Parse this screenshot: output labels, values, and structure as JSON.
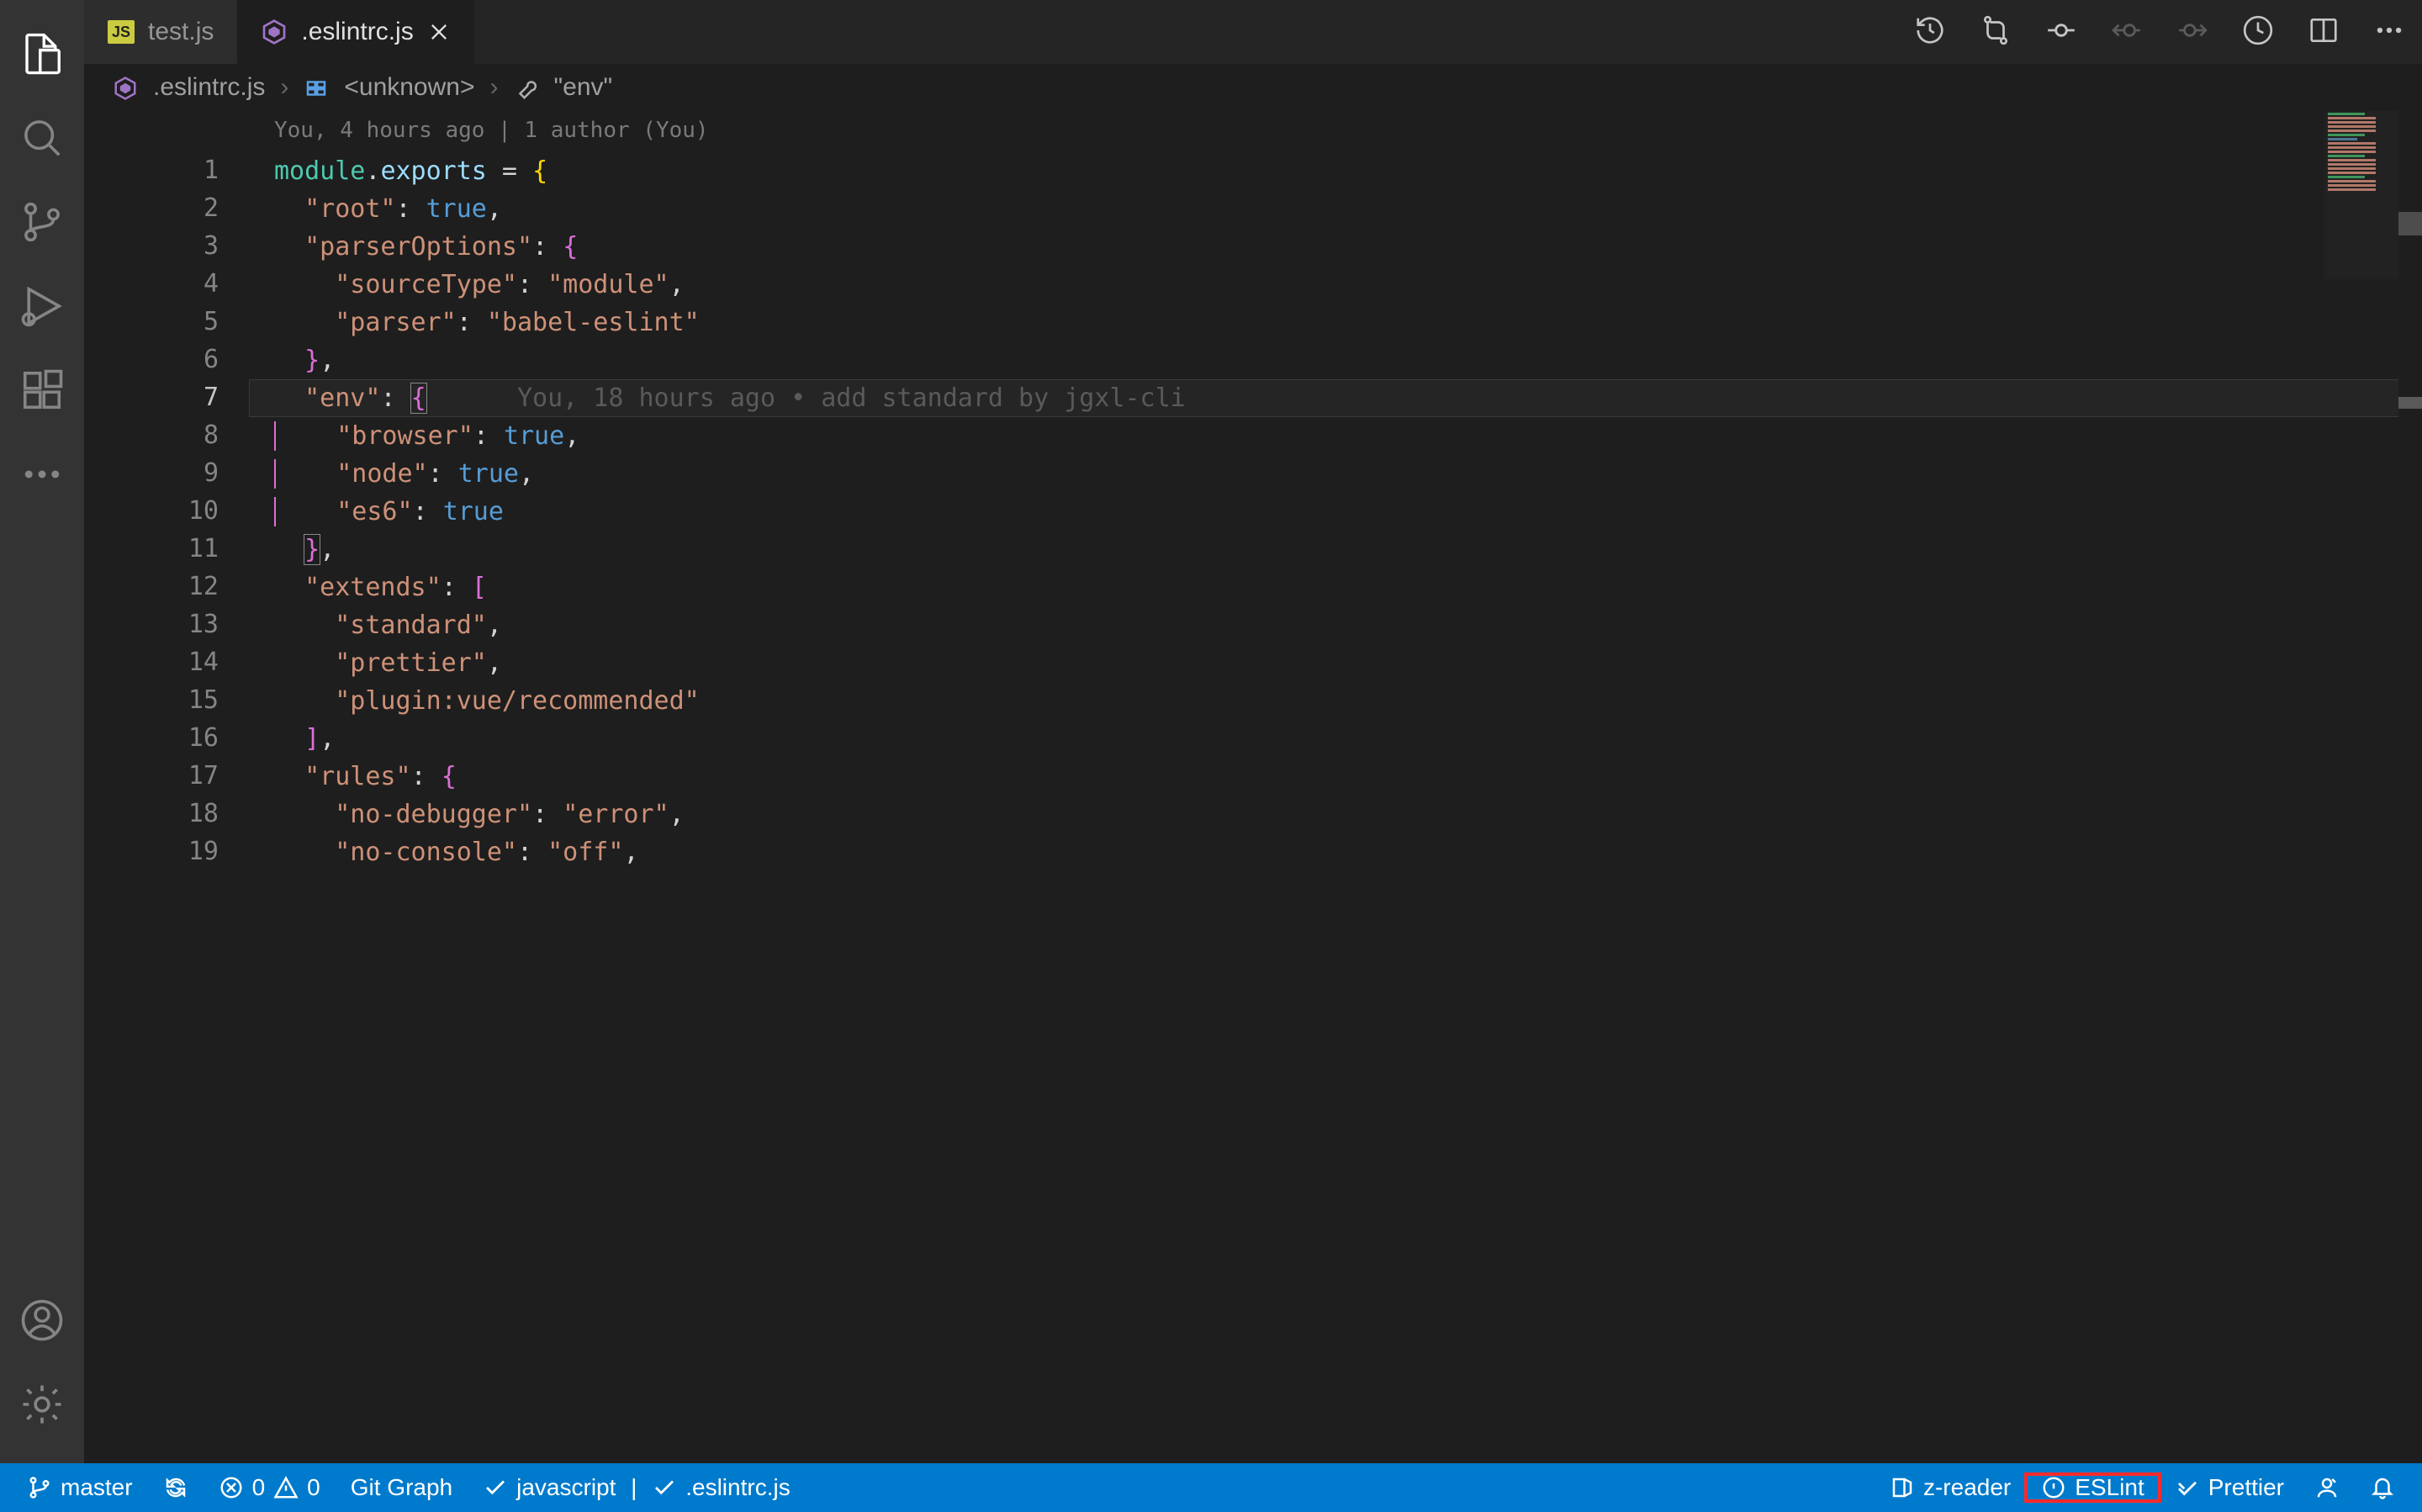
{
  "tabs": [
    {
      "label": "test.js",
      "icon": "js",
      "active": false
    },
    {
      "label": ".eslintrc.js",
      "icon": "eslint",
      "active": true
    }
  ],
  "breadcrumb": {
    "file": ".eslintrc.js",
    "symbol1": "<unknown>",
    "symbol2": "\"env\""
  },
  "codelens": "You, 4 hours ago | 1 author (You)",
  "blame_current_line": "You, 18 hours ago • add standard by jgxl-cli",
  "lines": [
    {
      "n": 1,
      "seg": [
        [
          "module",
          "var"
        ],
        [
          ".",
          "punc"
        ],
        [
          "exports",
          "prop"
        ],
        [
          " = ",
          "punc"
        ],
        [
          "{",
          "brace"
        ]
      ]
    },
    {
      "n": 2,
      "seg": [
        [
          "  ",
          ""
        ],
        [
          "\"root\"",
          "str"
        ],
        [
          ": ",
          "punc"
        ],
        [
          "true",
          "bool"
        ],
        [
          ",",
          "punc"
        ]
      ]
    },
    {
      "n": 3,
      "seg": [
        [
          "  ",
          ""
        ],
        [
          "\"parserOptions\"",
          "str"
        ],
        [
          ": ",
          "punc"
        ],
        [
          "{",
          "brace2"
        ]
      ]
    },
    {
      "n": 4,
      "seg": [
        [
          "    ",
          ""
        ],
        [
          "\"sourceType\"",
          "str"
        ],
        [
          ": ",
          "punc"
        ],
        [
          "\"module\"",
          "str"
        ],
        [
          ",",
          "punc"
        ]
      ]
    },
    {
      "n": 5,
      "seg": [
        [
          "    ",
          ""
        ],
        [
          "\"parser\"",
          "str"
        ],
        [
          ": ",
          "punc"
        ],
        [
          "\"babel-eslint\"",
          "str"
        ]
      ]
    },
    {
      "n": 6,
      "seg": [
        [
          "  ",
          ""
        ],
        [
          "}",
          "brace2"
        ],
        [
          ",",
          "punc"
        ]
      ]
    },
    {
      "n": 7,
      "seg": [
        [
          "  ",
          ""
        ],
        [
          "\"env\"",
          "str"
        ],
        [
          ": ",
          "punc"
        ],
        [
          "{",
          "brace2-hl"
        ]
      ],
      "current": true,
      "blame": true
    },
    {
      "n": 8,
      "seg": [
        [
          "    ",
          ""
        ],
        [
          "\"browser\"",
          "str"
        ],
        [
          ": ",
          "punc"
        ],
        [
          "true",
          "bool"
        ],
        [
          ",",
          "punc"
        ]
      ],
      "guide": true
    },
    {
      "n": 9,
      "seg": [
        [
          "    ",
          ""
        ],
        [
          "\"node\"",
          "str"
        ],
        [
          ": ",
          "punc"
        ],
        [
          "true",
          "bool"
        ],
        [
          ",",
          "punc"
        ]
      ],
      "guide": true
    },
    {
      "n": 10,
      "seg": [
        [
          "    ",
          ""
        ],
        [
          "\"es6\"",
          "str"
        ],
        [
          ": ",
          "punc"
        ],
        [
          "true",
          "bool"
        ]
      ],
      "guide": true
    },
    {
      "n": 11,
      "seg": [
        [
          "  ",
          ""
        ],
        [
          "}",
          "brace2-hl"
        ],
        [
          ",",
          "punc"
        ]
      ]
    },
    {
      "n": 12,
      "seg": [
        [
          "  ",
          ""
        ],
        [
          "\"extends\"",
          "str"
        ],
        [
          ": ",
          "punc"
        ],
        [
          "[",
          "brace2"
        ]
      ]
    },
    {
      "n": 13,
      "seg": [
        [
          "    ",
          ""
        ],
        [
          "\"standard\"",
          "str"
        ],
        [
          ",",
          "punc"
        ]
      ]
    },
    {
      "n": 14,
      "seg": [
        [
          "    ",
          ""
        ],
        [
          "\"prettier\"",
          "str"
        ],
        [
          ",",
          "punc"
        ]
      ]
    },
    {
      "n": 15,
      "seg": [
        [
          "    ",
          ""
        ],
        [
          "\"plugin:vue/recommended\"",
          "str"
        ]
      ]
    },
    {
      "n": 16,
      "seg": [
        [
          "  ",
          ""
        ],
        [
          "]",
          "brace2"
        ],
        [
          ",",
          "punc"
        ]
      ]
    },
    {
      "n": 17,
      "seg": [
        [
          "  ",
          ""
        ],
        [
          "\"rules\"",
          "str"
        ],
        [
          ": ",
          "punc"
        ],
        [
          "{",
          "brace2"
        ]
      ]
    },
    {
      "n": 18,
      "seg": [
        [
          "    ",
          ""
        ],
        [
          "\"no-debugger\"",
          "str"
        ],
        [
          ": ",
          "punc"
        ],
        [
          "\"error\"",
          "str"
        ],
        [
          ",",
          "punc"
        ]
      ]
    },
    {
      "n": 19,
      "seg": [
        [
          "    ",
          ""
        ],
        [
          "\"no-console\"",
          "str"
        ],
        [
          ": ",
          "punc"
        ],
        [
          "\"off\"",
          "str"
        ],
        [
          ",",
          "punc"
        ]
      ]
    }
  ],
  "status": {
    "branch": "master",
    "errors": "0",
    "warnings": "0",
    "git_graph": "Git Graph",
    "language": "javascript",
    "filetype": ".eslintrc.js",
    "zreader": "z-reader",
    "eslint": "ESLint",
    "prettier": "Prettier"
  }
}
